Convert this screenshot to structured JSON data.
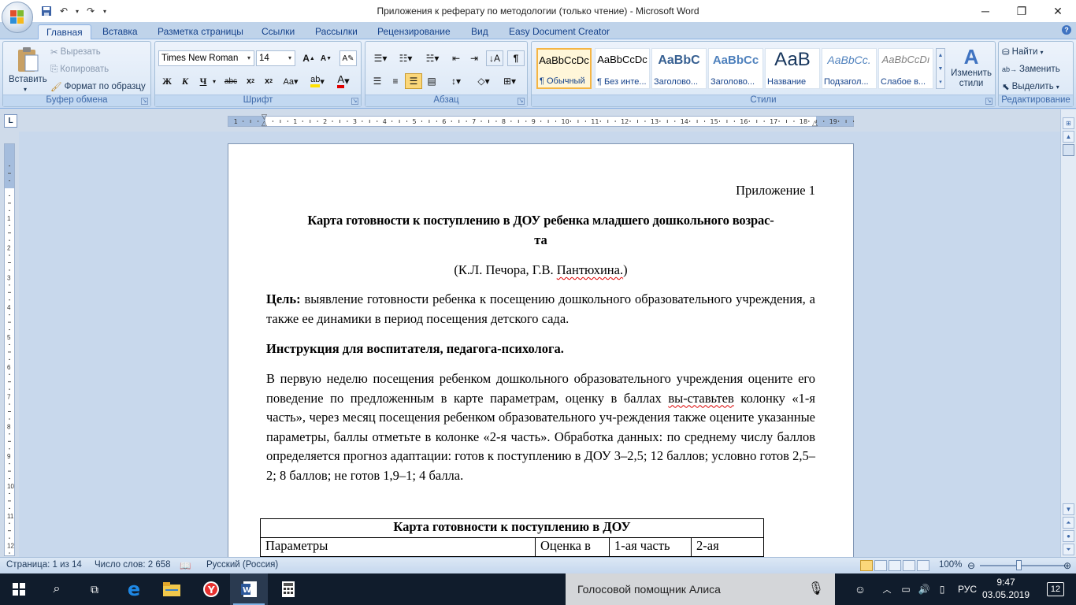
{
  "window": {
    "title": "Приложения к реферату по методологии (только чтение) - Microsoft Word"
  },
  "tabs": [
    "Главная",
    "Вставка",
    "Разметка страницы",
    "Ссылки",
    "Рассылки",
    "Рецензирование",
    "Вид",
    "Easy Document Creator"
  ],
  "ribbon": {
    "clipboard": {
      "label": "Буфер обмена",
      "paste": "Вставить",
      "cut": "Вырезать",
      "copy": "Копировать",
      "format_painter": "Формат по образцу"
    },
    "font": {
      "label": "Шрифт",
      "name": "Times New Roman",
      "size": "14"
    },
    "paragraph": {
      "label": "Абзац"
    },
    "styles": {
      "label": "Стили",
      "items": [
        {
          "sample": "AaBbCcDc",
          "name": "¶ Обычный"
        },
        {
          "sample": "AaBbCcDc",
          "name": "¶ Без инте..."
        },
        {
          "sample": "AaBbC",
          "name": "Заголово..."
        },
        {
          "sample": "AaBbCc",
          "name": "Заголово..."
        },
        {
          "sample": "АаВ",
          "name": "Название"
        },
        {
          "sample": "AaBbCc.",
          "name": "Подзагол..."
        },
        {
          "sample": "AaBbCcDı",
          "name": "Слабое в..."
        }
      ],
      "change_styles": "Изменить стили"
    },
    "editing": {
      "label": "Редактирование",
      "find": "Найти",
      "replace": "Заменить",
      "select": "Выделить"
    }
  },
  "document": {
    "appendix": "Приложение 1",
    "title_line1": "Карта готовности к поступлению в ДОУ ребенка младшего дошкольного возрас-",
    "title_line2": "та",
    "authors": "(К.Л. Печора, Г.В. ",
    "authors_misspelled": "Пантюхина.",
    "authors_end": ")",
    "goal_label": "Цель:",
    "goal_text": " выявление готовности ребенка к посещению дошкольного образовательного учреждения, а также ее динамики в период посещения детского сада.",
    "instruction": "Инструкция для воспитателя, педагога-психолога.",
    "body_part1": "В первую неделю посещения ребенком дошкольного образовательного учреждения оцените его поведение по предложенным в карте параметрам, оценку в баллах ",
    "body_misspelled1": "вы-ставьтев",
    "body_part2": " колонку «1-я часть», через месяц посещения ребенком образовательного уч-реждения также оцените указанные параметры, баллы отметьте в колонке «2-я часть». Обработка данных: по среднему числу баллов определяется прогноз адаптации: готов к поступлению в ДОУ 3–2,5; 12 баллов; условно готов 2,5–2; 8 баллов; не готов 1,9–1; 4 балла.",
    "table": {
      "caption": "Карта готовности к поступлению в ДОУ",
      "headers": [
        "Параметры",
        "Оценка в",
        "1-ая часть",
        "2-ая"
      ]
    }
  },
  "statusbar": {
    "page": "Страница: 1 из 14",
    "words": "Число слов: 2 658",
    "language": "Русский (Россия)",
    "zoom": "100%"
  },
  "taskbar": {
    "alice": "Голосовой помощник Алиса",
    "lang": "РУС",
    "time": "9:47",
    "date": "03.05.2019",
    "notifications": "12"
  }
}
